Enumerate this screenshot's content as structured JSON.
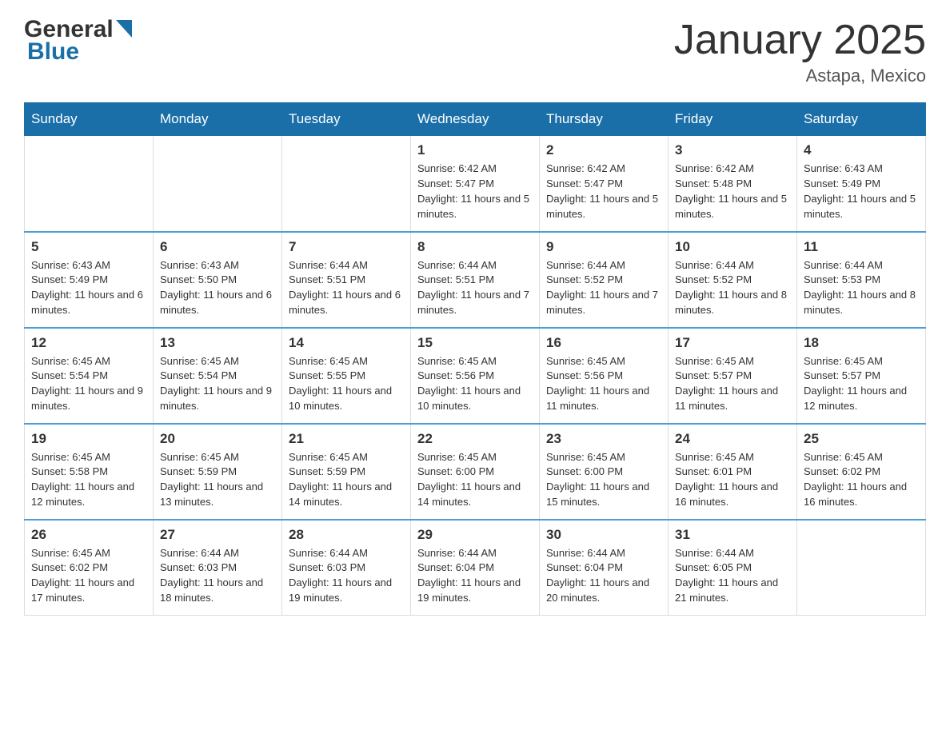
{
  "header": {
    "logo_text_general": "General",
    "logo_text_blue": "Blue",
    "month_title": "January 2025",
    "location": "Astapa, Mexico"
  },
  "days_of_week": [
    "Sunday",
    "Monday",
    "Tuesday",
    "Wednesday",
    "Thursday",
    "Friday",
    "Saturday"
  ],
  "weeks": [
    [
      {
        "day": "",
        "info": ""
      },
      {
        "day": "",
        "info": ""
      },
      {
        "day": "",
        "info": ""
      },
      {
        "day": "1",
        "info": "Sunrise: 6:42 AM\nSunset: 5:47 PM\nDaylight: 11 hours and 5 minutes."
      },
      {
        "day": "2",
        "info": "Sunrise: 6:42 AM\nSunset: 5:47 PM\nDaylight: 11 hours and 5 minutes."
      },
      {
        "day": "3",
        "info": "Sunrise: 6:42 AM\nSunset: 5:48 PM\nDaylight: 11 hours and 5 minutes."
      },
      {
        "day": "4",
        "info": "Sunrise: 6:43 AM\nSunset: 5:49 PM\nDaylight: 11 hours and 5 minutes."
      }
    ],
    [
      {
        "day": "5",
        "info": "Sunrise: 6:43 AM\nSunset: 5:49 PM\nDaylight: 11 hours and 6 minutes."
      },
      {
        "day": "6",
        "info": "Sunrise: 6:43 AM\nSunset: 5:50 PM\nDaylight: 11 hours and 6 minutes."
      },
      {
        "day": "7",
        "info": "Sunrise: 6:44 AM\nSunset: 5:51 PM\nDaylight: 11 hours and 6 minutes."
      },
      {
        "day": "8",
        "info": "Sunrise: 6:44 AM\nSunset: 5:51 PM\nDaylight: 11 hours and 7 minutes."
      },
      {
        "day": "9",
        "info": "Sunrise: 6:44 AM\nSunset: 5:52 PM\nDaylight: 11 hours and 7 minutes."
      },
      {
        "day": "10",
        "info": "Sunrise: 6:44 AM\nSunset: 5:52 PM\nDaylight: 11 hours and 8 minutes."
      },
      {
        "day": "11",
        "info": "Sunrise: 6:44 AM\nSunset: 5:53 PM\nDaylight: 11 hours and 8 minutes."
      }
    ],
    [
      {
        "day": "12",
        "info": "Sunrise: 6:45 AM\nSunset: 5:54 PM\nDaylight: 11 hours and 9 minutes."
      },
      {
        "day": "13",
        "info": "Sunrise: 6:45 AM\nSunset: 5:54 PM\nDaylight: 11 hours and 9 minutes."
      },
      {
        "day": "14",
        "info": "Sunrise: 6:45 AM\nSunset: 5:55 PM\nDaylight: 11 hours and 10 minutes."
      },
      {
        "day": "15",
        "info": "Sunrise: 6:45 AM\nSunset: 5:56 PM\nDaylight: 11 hours and 10 minutes."
      },
      {
        "day": "16",
        "info": "Sunrise: 6:45 AM\nSunset: 5:56 PM\nDaylight: 11 hours and 11 minutes."
      },
      {
        "day": "17",
        "info": "Sunrise: 6:45 AM\nSunset: 5:57 PM\nDaylight: 11 hours and 11 minutes."
      },
      {
        "day": "18",
        "info": "Sunrise: 6:45 AM\nSunset: 5:57 PM\nDaylight: 11 hours and 12 minutes."
      }
    ],
    [
      {
        "day": "19",
        "info": "Sunrise: 6:45 AM\nSunset: 5:58 PM\nDaylight: 11 hours and 12 minutes."
      },
      {
        "day": "20",
        "info": "Sunrise: 6:45 AM\nSunset: 5:59 PM\nDaylight: 11 hours and 13 minutes."
      },
      {
        "day": "21",
        "info": "Sunrise: 6:45 AM\nSunset: 5:59 PM\nDaylight: 11 hours and 14 minutes."
      },
      {
        "day": "22",
        "info": "Sunrise: 6:45 AM\nSunset: 6:00 PM\nDaylight: 11 hours and 14 minutes."
      },
      {
        "day": "23",
        "info": "Sunrise: 6:45 AM\nSunset: 6:00 PM\nDaylight: 11 hours and 15 minutes."
      },
      {
        "day": "24",
        "info": "Sunrise: 6:45 AM\nSunset: 6:01 PM\nDaylight: 11 hours and 16 minutes."
      },
      {
        "day": "25",
        "info": "Sunrise: 6:45 AM\nSunset: 6:02 PM\nDaylight: 11 hours and 16 minutes."
      }
    ],
    [
      {
        "day": "26",
        "info": "Sunrise: 6:45 AM\nSunset: 6:02 PM\nDaylight: 11 hours and 17 minutes."
      },
      {
        "day": "27",
        "info": "Sunrise: 6:44 AM\nSunset: 6:03 PM\nDaylight: 11 hours and 18 minutes."
      },
      {
        "day": "28",
        "info": "Sunrise: 6:44 AM\nSunset: 6:03 PM\nDaylight: 11 hours and 19 minutes."
      },
      {
        "day": "29",
        "info": "Sunrise: 6:44 AM\nSunset: 6:04 PM\nDaylight: 11 hours and 19 minutes."
      },
      {
        "day": "30",
        "info": "Sunrise: 6:44 AM\nSunset: 6:04 PM\nDaylight: 11 hours and 20 minutes."
      },
      {
        "day": "31",
        "info": "Sunrise: 6:44 AM\nSunset: 6:05 PM\nDaylight: 11 hours and 21 minutes."
      },
      {
        "day": "",
        "info": ""
      }
    ]
  ]
}
